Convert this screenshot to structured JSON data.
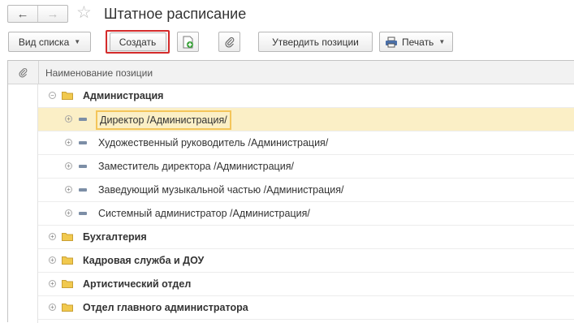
{
  "header": {
    "title": "Штатное расписание",
    "back_icon": "←",
    "forward_icon": "→",
    "star_icon": "☆"
  },
  "toolbar": {
    "view_label": "Вид списка",
    "create_label": "Создать",
    "approve_label": "Утвердить позиции",
    "print_label": "Печать",
    "caret": "▼"
  },
  "table": {
    "column_header": "Наименование позиции",
    "rows": [
      {
        "label": "Администрация",
        "type": "folder",
        "expanded": true
      },
      {
        "label": "Директор /Администрация/",
        "type": "item",
        "selected": true
      },
      {
        "label": "Художественный руководитель /Администрация/",
        "type": "item"
      },
      {
        "label": "Заместитель директора /Администрация/",
        "type": "item"
      },
      {
        "label": "Заведующий музыкальной частью /Администрация/",
        "type": "item"
      },
      {
        "label": "Системный администратор /Администрация/",
        "type": "item"
      },
      {
        "label": "Бухгалтерия",
        "type": "folder"
      },
      {
        "label": "Кадровая служба и ДОУ",
        "type": "folder"
      },
      {
        "label": "Артистический отдел",
        "type": "folder"
      },
      {
        "label": "Отдел главного администратора",
        "type": "folder"
      }
    ]
  },
  "colors": {
    "highlight_red": "#d42b2b",
    "selection_bg": "#fbefc6",
    "selection_border": "#f4c55a",
    "folder_yellow": "#f1c94e",
    "item_blue_gray": "#7c8ea6"
  }
}
